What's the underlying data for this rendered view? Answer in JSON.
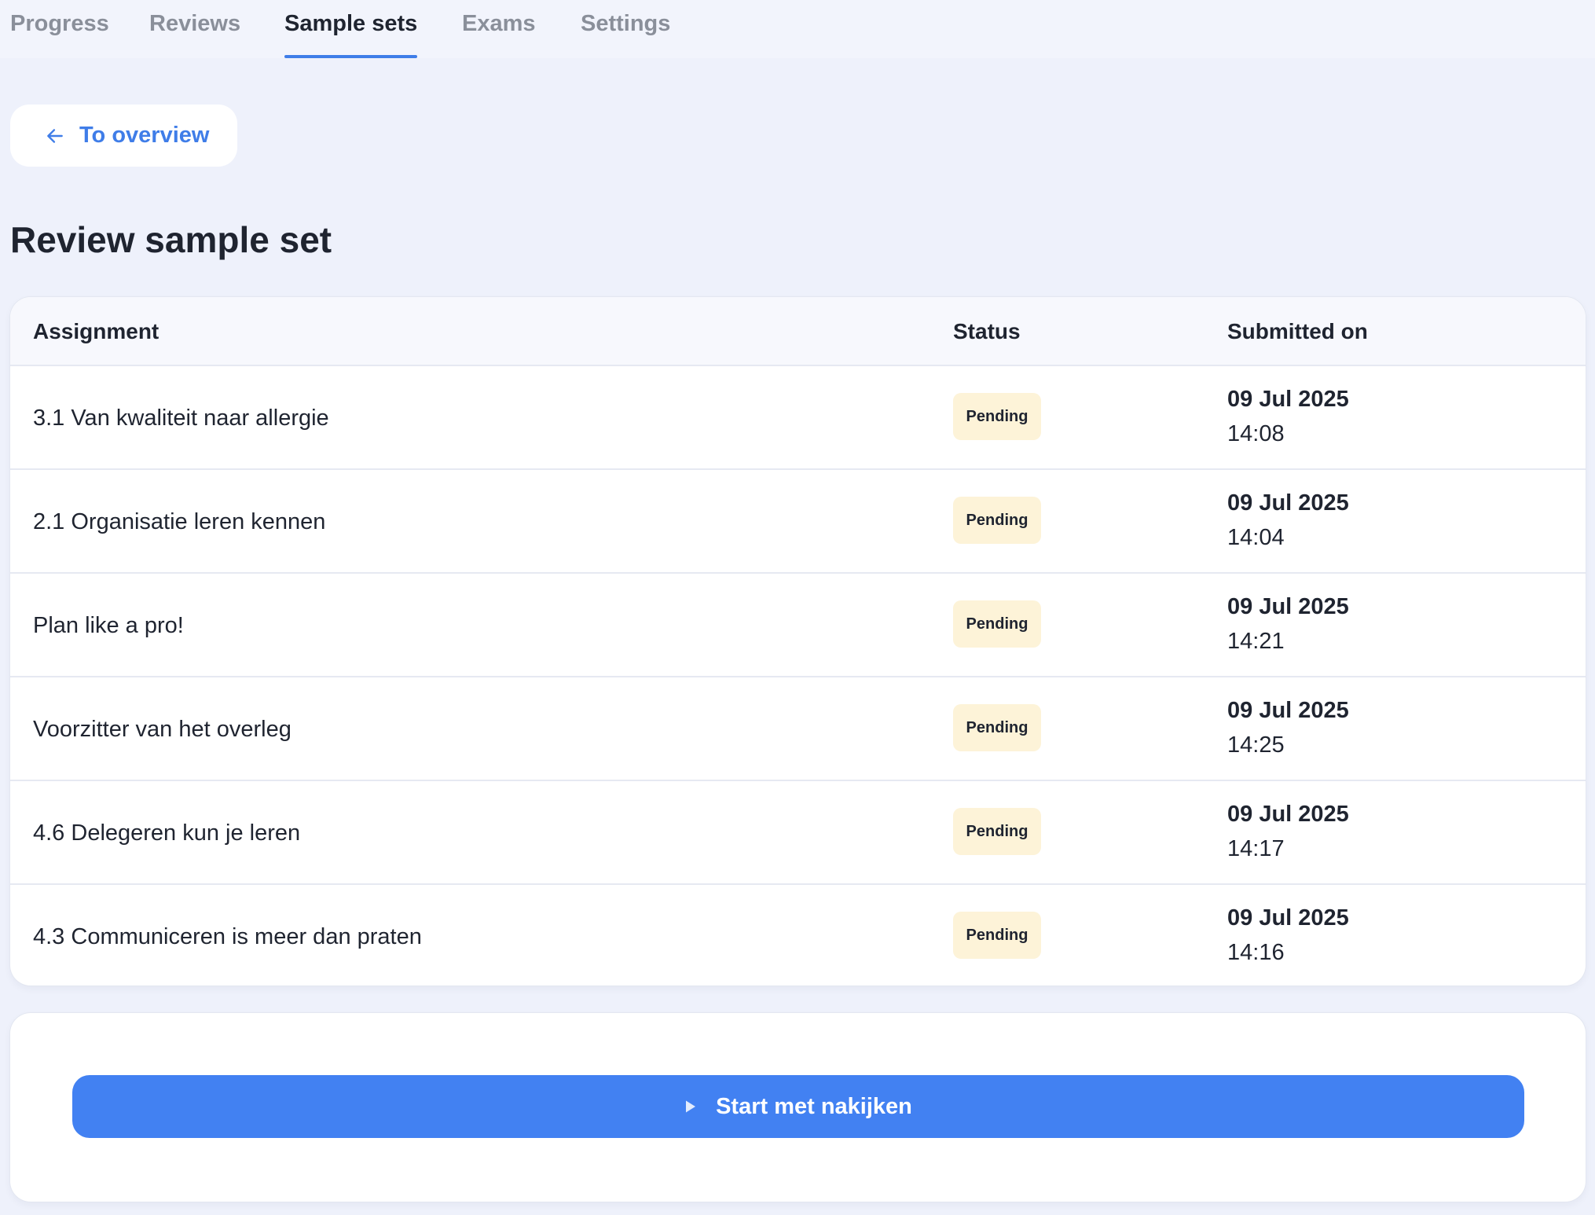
{
  "tabs": [
    {
      "label": "Progress",
      "active": false
    },
    {
      "label": "Reviews",
      "active": false
    },
    {
      "label": "Sample sets",
      "active": true
    },
    {
      "label": "Exams",
      "active": false
    },
    {
      "label": "Settings",
      "active": false
    }
  ],
  "back_button": {
    "label": "To overview",
    "icon": "arrow-left-icon"
  },
  "page_title": "Review sample set",
  "table": {
    "headers": {
      "assignment": "Assignment",
      "status": "Status",
      "submitted_on": "Submitted on"
    },
    "rows": [
      {
        "assignment": "3.1 Van kwaliteit naar allergie",
        "status": "Pending",
        "date": "09 Jul 2025",
        "time": "14:08"
      },
      {
        "assignment": "2.1 Organisatie leren kennen",
        "status": "Pending",
        "date": "09 Jul 2025",
        "time": "14:04"
      },
      {
        "assignment": "Plan like a pro!",
        "status": "Pending",
        "date": "09 Jul 2025",
        "time": "14:21"
      },
      {
        "assignment": "Voorzitter van het overleg",
        "status": "Pending",
        "date": "09 Jul 2025",
        "time": "14:25"
      },
      {
        "assignment": "4.6 Delegeren kun je leren",
        "status": "Pending",
        "date": "09 Jul 2025",
        "time": "14:17"
      },
      {
        "assignment": "4.3 Communiceren is meer dan praten",
        "status": "Pending",
        "date": "09 Jul 2025",
        "time": "14:16"
      }
    ]
  },
  "start_button": {
    "label": "Start met nakijken",
    "icon": "play-icon"
  },
  "colors": {
    "accent": "#3f7de8",
    "primary_button": "#4281f2",
    "pending_badge_bg": "#fdf3d8",
    "page_bg": "#eef1fb"
  }
}
